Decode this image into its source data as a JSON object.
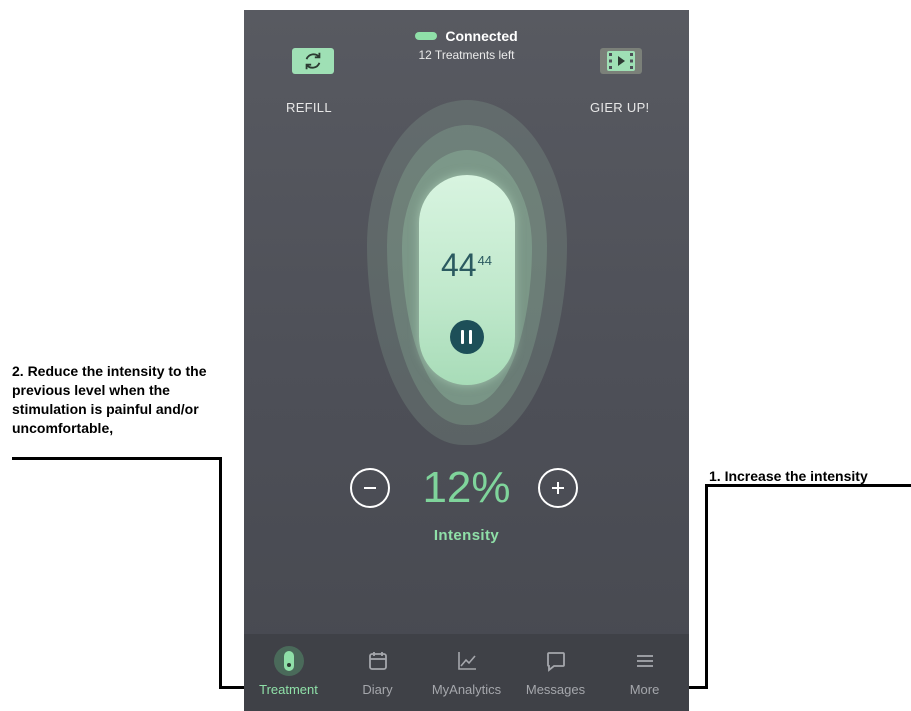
{
  "status": {
    "connection": "Connected",
    "treatments_left": "12 Treatments left"
  },
  "top_actions": {
    "refill_label": "REFILL",
    "gier_label": "GIER UP!"
  },
  "timer": {
    "main": "44",
    "sub": "44"
  },
  "intensity": {
    "value": "12%",
    "label": "Intensity"
  },
  "nav": [
    {
      "label": "Treatment",
      "icon": "treatment-icon",
      "active": true
    },
    {
      "label": "Diary",
      "icon": "calendar-icon",
      "active": false
    },
    {
      "label": "MyAnalytics",
      "icon": "chart-icon",
      "active": false
    },
    {
      "label": "Messages",
      "icon": "chat-icon",
      "active": false
    },
    {
      "label": "More",
      "icon": "menu-icon",
      "active": false
    }
  ],
  "annotations": {
    "left": "2. Reduce the intensity to the previous level when the stimulation is painful and/or uncomfortable,",
    "right": "1. Increase the intensity"
  },
  "colors": {
    "accent": "#8fe0a8",
    "background": "#4d4f57",
    "nav_bg": "#3f4147",
    "pause": "#1d4f58"
  }
}
